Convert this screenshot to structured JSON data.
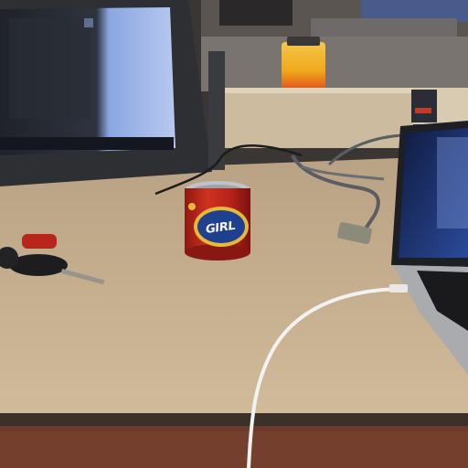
{
  "scene": {
    "description_tags": [
      "desk",
      "monitor",
      "laptop",
      "soda-can",
      "car-keys",
      "charging-cable"
    ],
    "can_label": "GIRL",
    "colors": {
      "desk": "#c9b191",
      "desk_edge": "#3b302a",
      "carpet": "#6b3a2a",
      "can_red": "#c8261e",
      "can_blue": "#1f3f8f",
      "can_gold": "#e7b93a",
      "monitor_bezel": "#2e2f33",
      "monitor_screen_dark": "#2a2e38",
      "monitor_screen_light": "#6e8fd6",
      "laptop_screen": "#1b2a5a",
      "bottle_yellow": "#f0b21a",
      "cable_white": "#f2f2f2",
      "cable_gray": "#5a5e63"
    }
  }
}
